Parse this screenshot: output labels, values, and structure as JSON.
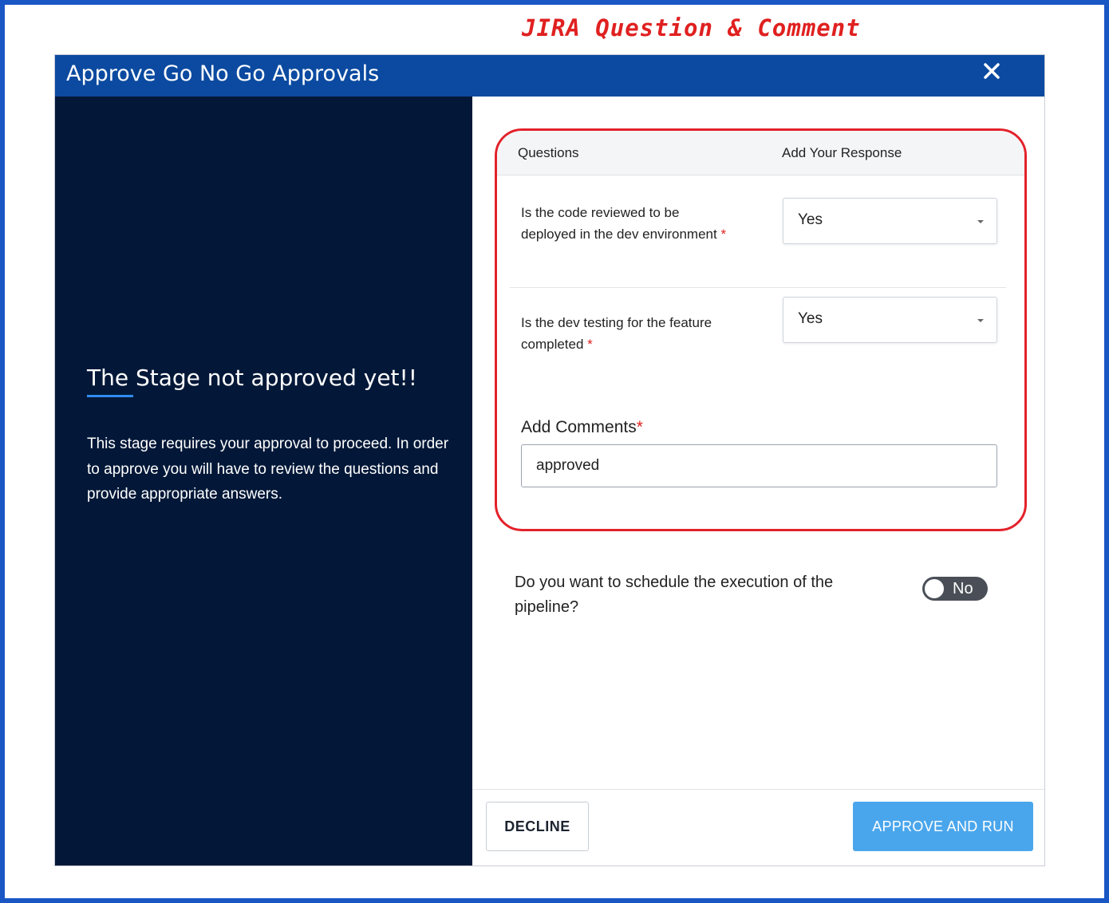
{
  "annotation": "JIRA Question & Comment",
  "dialog": {
    "title": "Approve Go No Go Approvals",
    "close_icon": "close-icon"
  },
  "left_panel": {
    "title": "The Stage not approved yet!!",
    "description": "This stage requires your approval to proceed. In order to approve you will have to review the questions and provide appropriate answers."
  },
  "questions_table": {
    "col_questions": "Questions",
    "col_response": "Add Your Response",
    "rows": [
      {
        "question": "Is the code reviewed to be deployed in the dev environment",
        "required_mark": "*",
        "response": "Yes"
      },
      {
        "question": "Is the dev testing for the feature completed",
        "required_mark": "*",
        "response": "Yes"
      }
    ]
  },
  "comments": {
    "label": "Add Comments",
    "required_mark": "*",
    "value": "approved"
  },
  "schedule": {
    "question": "Do you want to schedule the execution of the pipeline?",
    "toggle_label": "No",
    "toggle_on": false
  },
  "footer": {
    "decline_label": "DECLINE",
    "approve_label": "APPROVE AND RUN"
  },
  "colors": {
    "header": "#0b4aa0",
    "left_panel": "#031838",
    "highlight_border": "#e3222b",
    "approve_button": "#4aa6ec",
    "frame": "#1a56c4"
  }
}
